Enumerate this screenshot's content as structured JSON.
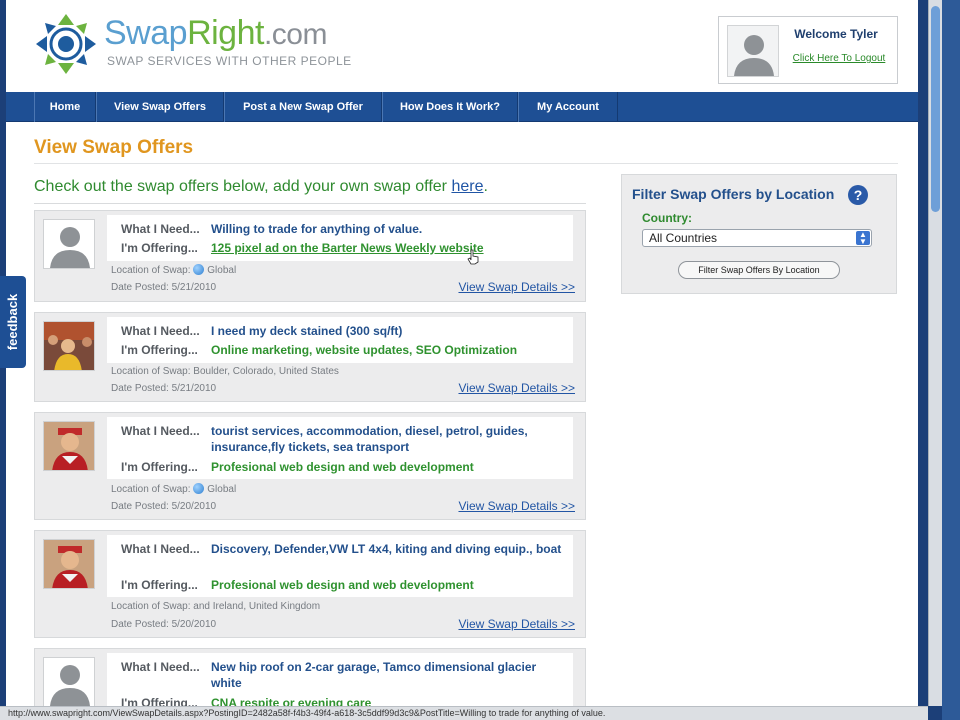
{
  "brand": {
    "name_part1": "Swap",
    "name_part2": "Right",
    "name_part3": ".com",
    "tagline": "SWAP SERVICES WITH OTHER PEOPLE",
    "colors": {
      "swap": "#5a9fd0",
      "right": "#6cb33f",
      "nav": "#1e4f94",
      "title": "#e0961f"
    }
  },
  "user": {
    "welcome": "Welcome Tyler",
    "logout": "Click Here To Logout"
  },
  "nav": {
    "items": [
      "Home",
      "View Swap Offers",
      "Post a New Swap Offer",
      "How Does It Work?",
      "My Account"
    ]
  },
  "page": {
    "title": "View Swap Offers",
    "intro_text": "Check out the swap offers below, add your own swap offer ",
    "intro_link": "here",
    "intro_end": "."
  },
  "labels": {
    "need": "What I Need...",
    "offering": "I'm Offering...",
    "location": "Location of Swap:",
    "date": "Date Posted:",
    "details": "View Swap Details >>"
  },
  "offers": [
    {
      "need": "Willing to trade for anything of value.",
      "offering": "125 pixel ad on the Barter News Weekly website",
      "location": "Global",
      "date": "5/21/2010",
      "avatar": "placeholder"
    },
    {
      "need": "I need my deck stained (300 sq/ft)",
      "offering": "Online marketing, website updates, SEO Optimization",
      "location": "Boulder, Colorado, United States",
      "date": "5/21/2010",
      "avatar": "photo-group"
    },
    {
      "need": "tourist services, accommodation, diesel, petrol, guides, insurance,fly tickets, sea transport",
      "offering": "Profesional web design and web development",
      "location": "Global",
      "date": "5/20/2010",
      "avatar": "photo-person"
    },
    {
      "need": "Discovery, Defender,VW LT 4x4, kiting and diving equip., boat",
      "offering": "Profesional web design and web development",
      "location": "and Ireland, United Kingdom",
      "date": "5/20/2010",
      "avatar": "photo-person"
    },
    {
      "need": "New hip roof on 2-car garage, Tamco dimensional glacier white",
      "offering": "CNA respite or evening care",
      "avatar": "placeholder"
    }
  ],
  "filter": {
    "title": "Filter Swap Offers by Location",
    "help": "?",
    "country_label": "Country:",
    "country_selected": "All Countries",
    "button": "Filter Swap Offers By Location"
  },
  "feedback": "feedback",
  "status_bar": "http://www.swapright.com/ViewSwapDetails.aspx?PostingID=2482a58f-f4b3-49f4-a618-3c5ddf99d3c9&PostTitle=Willing to trade for anything of value."
}
